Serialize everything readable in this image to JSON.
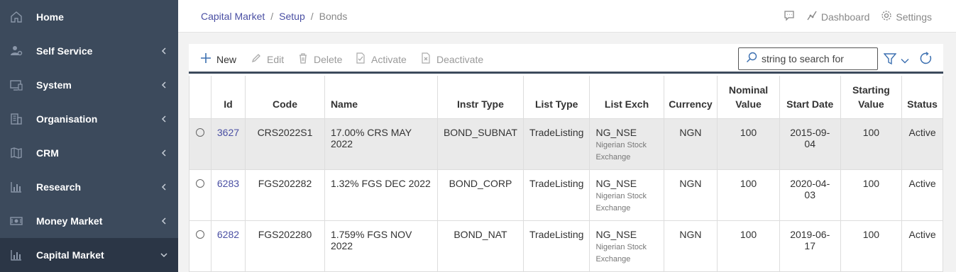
{
  "sidebar": {
    "items": [
      {
        "label": "Home",
        "icon": "home-icon"
      },
      {
        "label": "Self Service",
        "icon": "user-gear-icon"
      },
      {
        "label": "System",
        "icon": "monitor-icon"
      },
      {
        "label": "Organisation",
        "icon": "building-icon"
      },
      {
        "label": "CRM",
        "icon": "map-icon"
      },
      {
        "label": "Research",
        "icon": "bar-chart-icon"
      },
      {
        "label": "Money Market",
        "icon": "cash-icon"
      },
      {
        "label": "Capital Market",
        "icon": "bar-chart-icon"
      }
    ]
  },
  "breadcrumb": {
    "items": [
      "Capital Market",
      "Setup"
    ],
    "current": "Bonds",
    "sep": "/"
  },
  "header": {
    "dashboard": "Dashboard",
    "settings": "Settings"
  },
  "toolbar": {
    "new": "New",
    "edit": "Edit",
    "delete": "Delete",
    "activate": "Activate",
    "deactivate": "Deactivate",
    "search_placeholder": "string to search for"
  },
  "table": {
    "headers": {
      "id": "Id",
      "code": "Code",
      "name": "Name",
      "instr_type": "Instr Type",
      "list_type": "List Type",
      "list_exch": "List Exch",
      "currency": "Currency",
      "nominal_value": "Nominal Value",
      "start_date": "Start Date",
      "starting_value": "Starting Value",
      "status": "Status"
    },
    "rows": [
      {
        "id": "3627",
        "code": "CRS2022S1",
        "name": "17.00% CRS MAY 2022",
        "instr_type": "BOND_SUBNAT",
        "list_type": "TradeListing",
        "list_exch": "NG_NSE",
        "list_exch_desc": "Nigerian Stock Exchange",
        "currency": "NGN",
        "nominal_value": "100",
        "start_date": "2015-09-04",
        "starting_value": "100",
        "status": "Active"
      },
      {
        "id": "6283",
        "code": "FGS202282",
        "name": "1.32% FGS DEC 2022",
        "instr_type": "BOND_CORP",
        "list_type": "TradeListing",
        "list_exch": "NG_NSE",
        "list_exch_desc": "Nigerian Stock Exchange",
        "currency": "NGN",
        "nominal_value": "100",
        "start_date": "2020-04-03",
        "starting_value": "100",
        "status": "Active"
      },
      {
        "id": "6282",
        "code": "FGS202280",
        "name": "1.759% FGS NOV 2022",
        "instr_type": "BOND_NAT",
        "list_type": "TradeListing",
        "list_exch": "NG_NSE",
        "list_exch_desc": "Nigerian Stock Exchange",
        "currency": "NGN",
        "nominal_value": "100",
        "start_date": "2019-06-17",
        "starting_value": "100",
        "status": "Active"
      }
    ]
  },
  "colors": {
    "sidebar_bg": "#3c4a5c",
    "sidebar_active": "#2b3646",
    "link": "#4a4fa3",
    "accent": "#3b6fb0"
  }
}
